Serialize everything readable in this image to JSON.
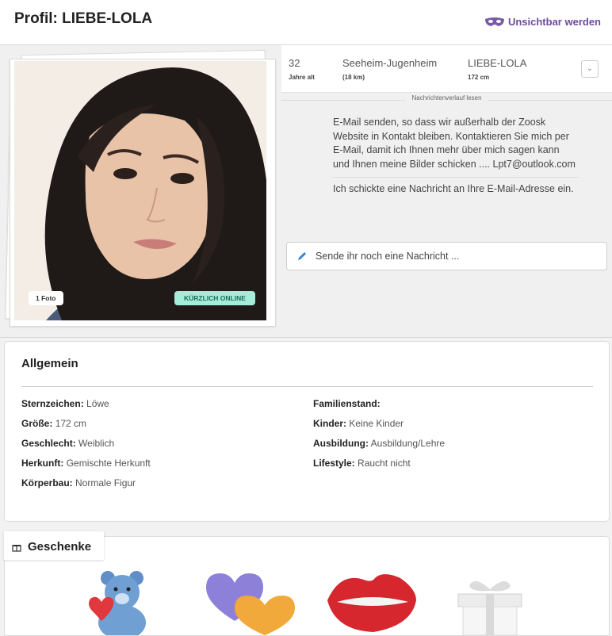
{
  "header": {
    "title": "Profil: LIEBE-LOLA",
    "invisible_label": "Unsichtbar werden",
    "accent": "#6b4c9a"
  },
  "stats": {
    "age_value": "32",
    "age_label": "Jahre alt",
    "location_value": "Seeheim-Jugenheim",
    "location_label": "(18 km)",
    "name_value": "LIEBE-LOLA",
    "name_label": "172 cm"
  },
  "history_label": "Nachrichtenverlauf lesen",
  "messages": [
    "wissen Sie mehr. Sie können eine Nachricht an meine E-Mail senden, so dass wir außerhalb der Zoosk Website in Kontakt bleiben. Kontaktieren Sie mich per E-Mail, damit ich Ihnen mehr über mich sagen kann und Ihnen meine Bilder schicken .... Lpt7@outlook.com",
    "Ich schickte eine Nachricht an Ihre E-Mail-Adresse ein."
  ],
  "compose_placeholder": "Sende ihr noch eine Nachricht ...",
  "photo": {
    "count_badge": "1 Foto",
    "online_badge": "KÜRZLICH ONLINE"
  },
  "general": {
    "title": "Allgemein",
    "left": [
      {
        "label": "Sternzeichen:",
        "value": "Löwe"
      },
      {
        "label": "Größe:",
        "value": "172 cm"
      },
      {
        "label": "Geschlecht:",
        "value": "Weiblich"
      },
      {
        "label": "Herkunft:",
        "value": "Gemischte Herkunft"
      },
      {
        "label": "Körperbau:",
        "value": "Normale Figur"
      }
    ],
    "right": [
      {
        "label": "Familienstand:",
        "value": ""
      },
      {
        "label": "Kinder:",
        "value": "Keine Kinder"
      },
      {
        "label": "Ausbildung:",
        "value": "Ausbildung/Lehre"
      },
      {
        "label": "Lifestyle:",
        "value": "Raucht nicht"
      }
    ]
  },
  "gifts": {
    "title": "Geschenke",
    "items": [
      "teddy-bear-icon",
      "hearts-icon",
      "kiss-lips-icon",
      "gift-box-icon"
    ]
  }
}
